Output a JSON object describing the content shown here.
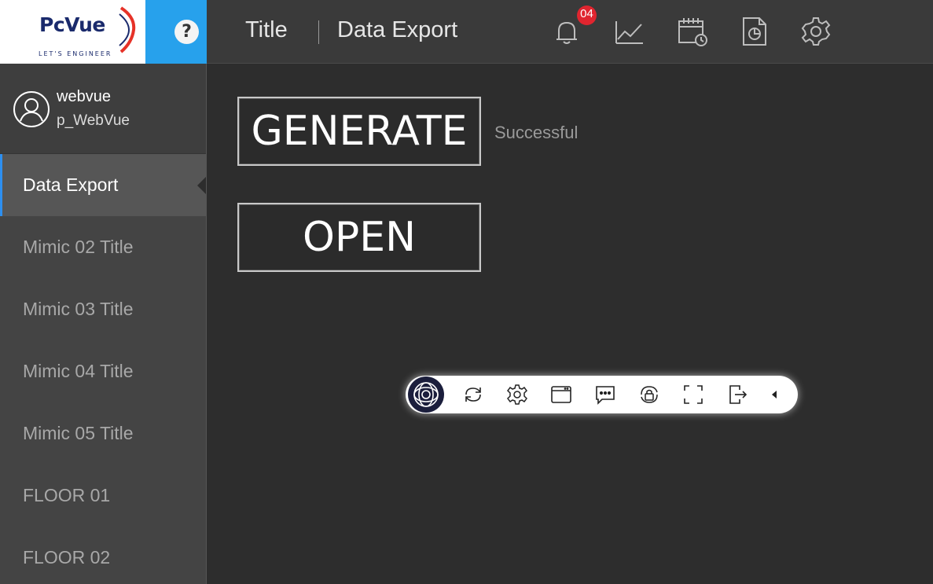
{
  "header": {
    "logo_text": "PcVue",
    "logo_tagline": "LET'S ENGINEER",
    "help_label": "?",
    "title": "Title",
    "subtitle": "Data Export",
    "alarm_count": "04",
    "icons": [
      "bell-icon",
      "trend-icon",
      "scheduler-icon",
      "report-icon",
      "settings-icon"
    ]
  },
  "user": {
    "name": "webvue",
    "profile": "p_WebVue"
  },
  "sidebar": {
    "items": [
      {
        "label": "Data Export",
        "active": true
      },
      {
        "label": "Mimic 02 Title"
      },
      {
        "label": "Mimic 03 Title"
      },
      {
        "label": "Mimic 04 Title"
      },
      {
        "label": "Mimic 05 Title"
      },
      {
        "label": "FLOOR 01"
      },
      {
        "label": "FLOOR 02"
      }
    ]
  },
  "main": {
    "generate_label": "GENERATE",
    "open_label": "OPEN",
    "status": "Successful"
  },
  "toolbar": {
    "icons": [
      "app-logo-icon",
      "refresh-icon",
      "gear-icon",
      "window-icon",
      "chat-icon",
      "lock-rotate-icon",
      "fullscreen-icon",
      "logout-icon",
      "collapse-icon"
    ]
  },
  "colors": {
    "accent_blue": "#27a1ec",
    "badge_red": "#e0252f",
    "background": "#2d2d2d",
    "sidebar": "#444444"
  }
}
